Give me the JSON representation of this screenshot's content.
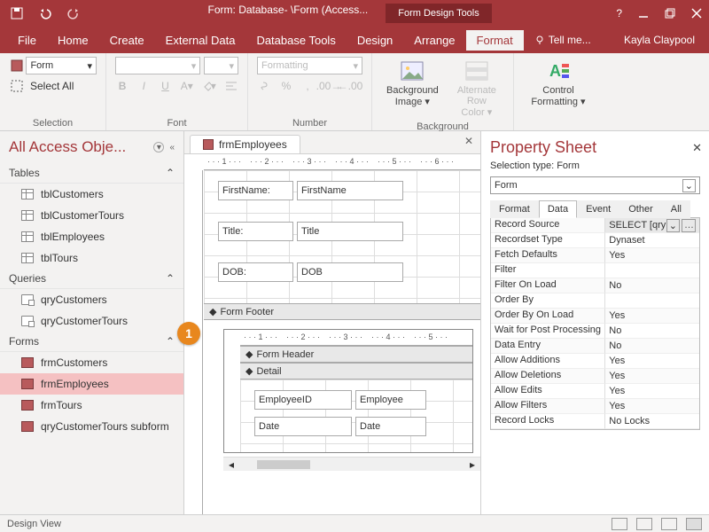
{
  "titlebar": {
    "title": "Form: Database- \\Form (Access...",
    "contextual": "Form Design Tools"
  },
  "menu": {
    "file": "File",
    "home": "Home",
    "create": "Create",
    "external": "External Data",
    "dbtools": "Database Tools",
    "design": "Design",
    "arrange": "Arrange",
    "format": "Format",
    "tellme": "Tell me...",
    "user": "Kayla Claypool"
  },
  "ribbon": {
    "selection": {
      "selector_value": "Form",
      "select_all": "Select All",
      "group_label": "Selection"
    },
    "font": {
      "bold": "B",
      "italic": "I",
      "underline": "U",
      "group_label": "Font"
    },
    "number": {
      "format_value": "Formatting",
      "group_label": "Number"
    },
    "background": {
      "bg_image": "Background Image",
      "alt_row": "Alternate Row Color",
      "group_label": "Background"
    },
    "ctrlfmt": {
      "label": "Control Formatting",
      "group_label": ""
    }
  },
  "nav": {
    "header": "All Access Obje...",
    "cats": {
      "tables": "Tables",
      "queries": "Queries",
      "forms": "Forms"
    },
    "tables": [
      "tblCustomers",
      "tblCustomerTours",
      "tblEmployees",
      "tblTours"
    ],
    "queries": [
      "qryCustomers",
      "qryCustomerTours"
    ],
    "forms": [
      "frmCustomers",
      "frmEmployees",
      "frmTours",
      "qryCustomerTours subform"
    ],
    "selected": "frmEmployees"
  },
  "design": {
    "tab": "frmEmployees",
    "fields": [
      {
        "label": "FirstName:",
        "control": "FirstName"
      },
      {
        "label": "Title:",
        "control": "Title"
      },
      {
        "label": "DOB:",
        "control": "DOB"
      }
    ],
    "sections": {
      "footer": "Form Footer",
      "header": "Form Header",
      "detail": "Detail"
    },
    "subfields": [
      {
        "label": "EmployeeID",
        "control": "Employee"
      },
      {
        "label": "Date",
        "control": "Date"
      }
    ]
  },
  "callout": "1",
  "propsheet": {
    "title": "Property Sheet",
    "seltype": "Selection type:  Form",
    "object": "Form",
    "tabs": {
      "format": "Format",
      "data": "Data",
      "event": "Event",
      "other": "Other",
      "all": "All"
    },
    "rows": [
      {
        "k": "Record Source",
        "v": "SELECT [qry",
        "btn": true
      },
      {
        "k": "Recordset Type",
        "v": "Dynaset"
      },
      {
        "k": "Fetch Defaults",
        "v": "Yes"
      },
      {
        "k": "Filter",
        "v": ""
      },
      {
        "k": "Filter On Load",
        "v": "No"
      },
      {
        "k": "Order By",
        "v": ""
      },
      {
        "k": "Order By On Load",
        "v": "Yes"
      },
      {
        "k": "Wait for Post Processing",
        "v": "No"
      },
      {
        "k": "Data Entry",
        "v": "No"
      },
      {
        "k": "Allow Additions",
        "v": "Yes"
      },
      {
        "k": "Allow Deletions",
        "v": "Yes"
      },
      {
        "k": "Allow Edits",
        "v": "Yes"
      },
      {
        "k": "Allow Filters",
        "v": "Yes"
      },
      {
        "k": "Record Locks",
        "v": "No Locks"
      }
    ]
  },
  "status": {
    "view": "Design View"
  }
}
